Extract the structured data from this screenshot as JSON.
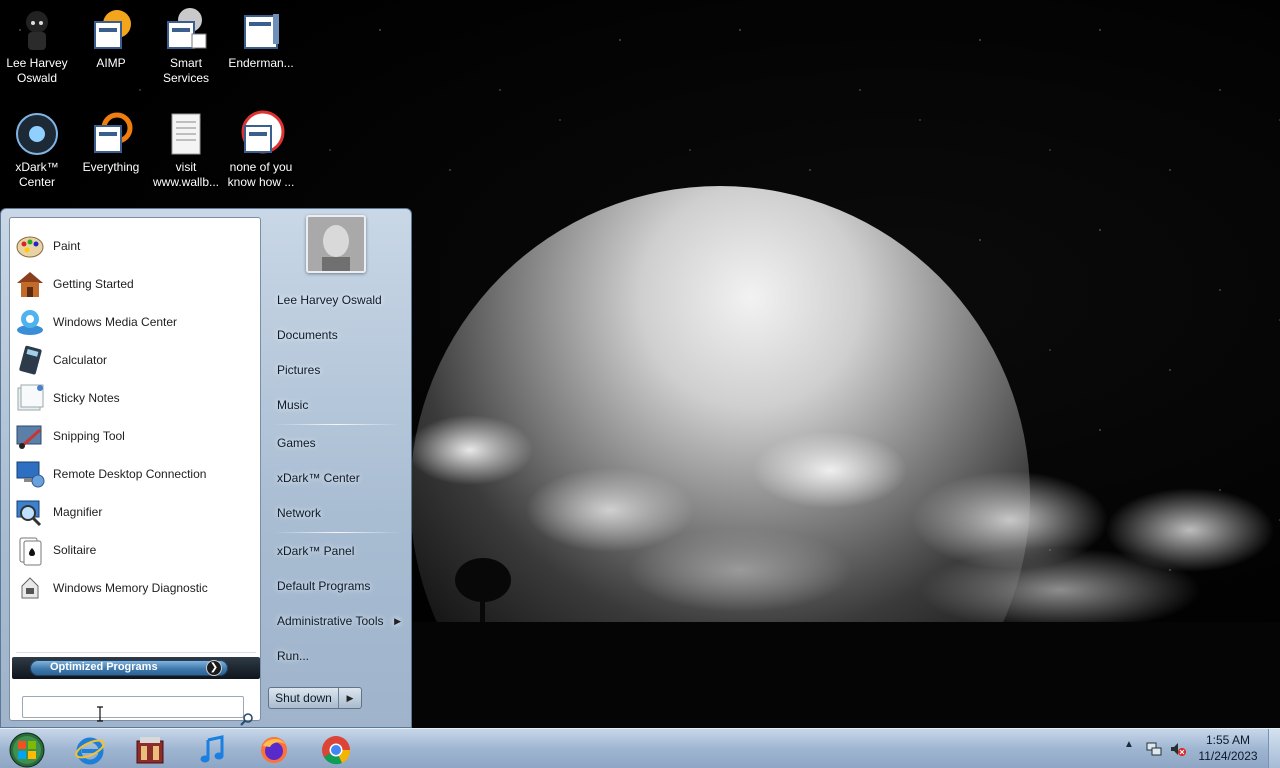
{
  "desktop": {
    "icons": [
      {
        "label": "Lee Harvey\nOswald",
        "icon": "user-folder-icon"
      },
      {
        "label": "AIMP",
        "icon": "aimp-icon"
      },
      {
        "label": "Smart\nServices",
        "icon": "smart-services-icon"
      },
      {
        "label": "Enderman...",
        "icon": "app-window-icon"
      },
      {
        "label": "xDark™\nCenter",
        "icon": "xdark-center-icon"
      },
      {
        "label": "Everything",
        "icon": "everything-icon"
      },
      {
        "label": "visit\nwww.wallb...",
        "icon": "text-file-icon"
      },
      {
        "label": "none of you\nknow how ...",
        "icon": "app-window-icon"
      }
    ]
  },
  "start_menu": {
    "programs": [
      {
        "label": "Paint",
        "icon": "paint-icon"
      },
      {
        "label": "Getting Started",
        "icon": "getting-started-icon"
      },
      {
        "label": "Windows Media Center",
        "icon": "media-center-icon"
      },
      {
        "label": "Calculator",
        "icon": "calculator-icon"
      },
      {
        "label": "Sticky Notes",
        "icon": "sticky-notes-icon"
      },
      {
        "label": "Snipping Tool",
        "icon": "snipping-tool-icon"
      },
      {
        "label": "Remote Desktop Connection",
        "icon": "remote-desktop-icon"
      },
      {
        "label": "Magnifier",
        "icon": "magnifier-icon"
      },
      {
        "label": "Solitaire",
        "icon": "solitaire-icon"
      },
      {
        "label": "Windows Memory Diagnostic",
        "icon": "memory-diagnostic-icon"
      }
    ],
    "optimized_label": "Optimized Programs",
    "search_placeholder": "",
    "right_items": [
      {
        "label": "Lee Harvey Oswald"
      },
      {
        "label": "Documents"
      },
      {
        "label": "Pictures"
      },
      {
        "label": "Music"
      },
      {
        "label": "Games"
      },
      {
        "label": "xDark™ Center"
      },
      {
        "label": "Network"
      },
      {
        "label": "xDark™ Panel"
      },
      {
        "label": "Default Programs"
      },
      {
        "label": "Administrative Tools",
        "submenu": true
      },
      {
        "label": "Run..."
      }
    ],
    "shutdown_label": "Shut down"
  },
  "taskbar": {
    "pinned": [
      {
        "name": "internet-explorer-icon"
      },
      {
        "name": "app-store-icon"
      },
      {
        "name": "itunes-music-icon"
      },
      {
        "name": "firefox-icon"
      },
      {
        "name": "chrome-icon"
      }
    ],
    "clock_time": "1:55 AM",
    "clock_date": "11/24/2023"
  },
  "colors": {
    "taskbar_top": "#c7d7ea",
    "start_menu_bg": "#a8bcd2",
    "optimized_pill": "#3f79ad"
  }
}
